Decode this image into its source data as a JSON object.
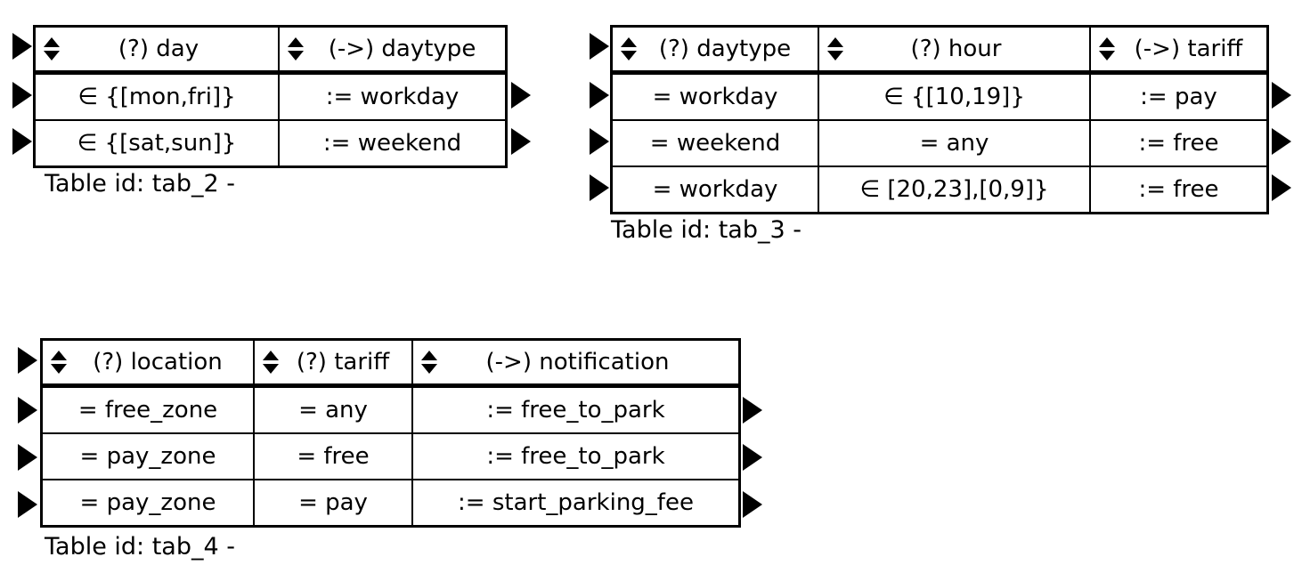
{
  "page": {
    "background": "#ffffff",
    "foreground": "#000000"
  },
  "icons": {
    "sort_up": "triangle-up-icon",
    "sort_down": "triangle-down-icon",
    "row_marker": "triangle-right-icon"
  },
  "tables": [
    {
      "id": "tab_2",
      "caption": "Table id: tab_2 -",
      "columns": [
        {
          "label": "(?) day",
          "kind": "input",
          "align": "center"
        },
        {
          "label": "(->) daytype",
          "kind": "output",
          "align": "center"
        }
      ],
      "rows": [
        {
          "cells": [
            "∈ {[mon,fri]}",
            ":= workday"
          ]
        },
        {
          "cells": [
            "∈ {[sat,sun]}",
            ":= weekend"
          ]
        }
      ]
    },
    {
      "id": "tab_3",
      "caption": "Table id: tab_3 -",
      "columns": [
        {
          "label": "(?) daytype",
          "kind": "input",
          "align": "center"
        },
        {
          "label": "(?) hour",
          "kind": "input",
          "align": "center"
        },
        {
          "label": "(->) tariff",
          "kind": "output",
          "align": "center"
        }
      ],
      "rows": [
        {
          "cells": [
            "= workday",
            "∈ {[10,19]}",
            ":= pay"
          ]
        },
        {
          "cells": [
            "= weekend",
            "= any",
            ":= free"
          ]
        },
        {
          "cells": [
            "= workday",
            "∈ [20,23],[0,9]}",
            ":= free"
          ]
        }
      ]
    },
    {
      "id": "tab_4",
      "caption": "Table id: tab_4 -",
      "columns": [
        {
          "label": "(?) location",
          "kind": "input",
          "align": "center"
        },
        {
          "label": "(?) tariff",
          "kind": "input",
          "align": "center"
        },
        {
          "label": "(->) notification",
          "kind": "output",
          "align": "center"
        }
      ],
      "rows": [
        {
          "cells": [
            "= free_zone",
            "= any",
            ":= free_to_park"
          ]
        },
        {
          "cells": [
            "= pay_zone",
            "= free",
            ":= free_to_park"
          ]
        },
        {
          "cells": [
            "= pay_zone",
            "= pay",
            ":= start_parking_fee"
          ]
        }
      ]
    }
  ]
}
